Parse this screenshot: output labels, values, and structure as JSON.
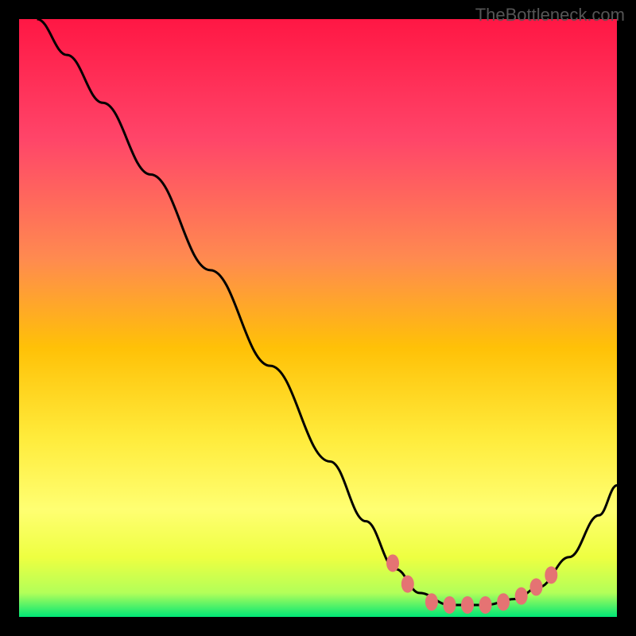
{
  "watermark": "TheBottleneck.com",
  "chart_data": {
    "type": "line",
    "title": "",
    "xlabel": "",
    "ylabel": "",
    "x_range": [
      0,
      100
    ],
    "y_range": [
      0,
      100
    ],
    "gradient_stops": [
      {
        "offset": 0,
        "color": "#ff1744"
      },
      {
        "offset": 20,
        "color": "#ff4569"
      },
      {
        "offset": 40,
        "color": "#ff8a50"
      },
      {
        "offset": 55,
        "color": "#ffc107"
      },
      {
        "offset": 70,
        "color": "#ffeb3b"
      },
      {
        "offset": 82,
        "color": "#ffff72"
      },
      {
        "offset": 90,
        "color": "#eeff41"
      },
      {
        "offset": 96,
        "color": "#b2ff59"
      },
      {
        "offset": 100,
        "color": "#00e676"
      }
    ],
    "series": [
      {
        "name": "bottleneck-curve",
        "color": "#000000",
        "points": [
          {
            "x": 3,
            "y": 100
          },
          {
            "x": 8,
            "y": 94
          },
          {
            "x": 14,
            "y": 86
          },
          {
            "x": 22,
            "y": 74
          },
          {
            "x": 32,
            "y": 58
          },
          {
            "x": 42,
            "y": 42
          },
          {
            "x": 52,
            "y": 26
          },
          {
            "x": 58,
            "y": 16
          },
          {
            "x": 63,
            "y": 8
          },
          {
            "x": 67,
            "y": 4
          },
          {
            "x": 72,
            "y": 2
          },
          {
            "x": 78,
            "y": 2
          },
          {
            "x": 83,
            "y": 3
          },
          {
            "x": 87,
            "y": 5
          },
          {
            "x": 92,
            "y": 10
          },
          {
            "x": 97,
            "y": 17
          },
          {
            "x": 100,
            "y": 22
          }
        ]
      }
    ],
    "markers": [
      {
        "x": 62.5,
        "y": 9,
        "color": "#e57373"
      },
      {
        "x": 65,
        "y": 5.5,
        "color": "#e57373"
      },
      {
        "x": 69,
        "y": 2.5,
        "color": "#e57373"
      },
      {
        "x": 72,
        "y": 2,
        "color": "#e57373"
      },
      {
        "x": 75,
        "y": 2,
        "color": "#e57373"
      },
      {
        "x": 78,
        "y": 2,
        "color": "#e57373"
      },
      {
        "x": 81,
        "y": 2.5,
        "color": "#e57373"
      },
      {
        "x": 84,
        "y": 3.5,
        "color": "#e57373"
      },
      {
        "x": 86.5,
        "y": 5,
        "color": "#e57373"
      },
      {
        "x": 89,
        "y": 7,
        "color": "#e57373"
      }
    ]
  }
}
